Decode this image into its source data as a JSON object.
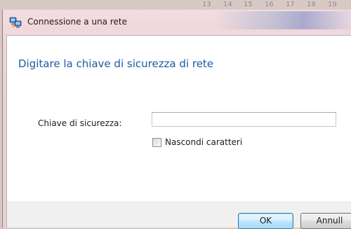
{
  "background_calendar": {
    "days": [
      "13",
      "14",
      "15",
      "16",
      "17",
      "18",
      "19"
    ]
  },
  "window": {
    "title": "Connessione a una rete",
    "title_icon": "network-connection-icon"
  },
  "dialog": {
    "heading": "Digitare la chiave di sicurezza di rete",
    "key_label": "Chiave di sicurezza:",
    "key_value": "",
    "hide_chars_label": "Nascondi caratteri",
    "hide_chars_checked": false
  },
  "buttons": {
    "ok_label": "OK",
    "cancel_label": "Annull"
  },
  "colors": {
    "heading": "#1d5aa6",
    "title_bar": "#ecd3d6",
    "footer": "#f0f0f0"
  }
}
